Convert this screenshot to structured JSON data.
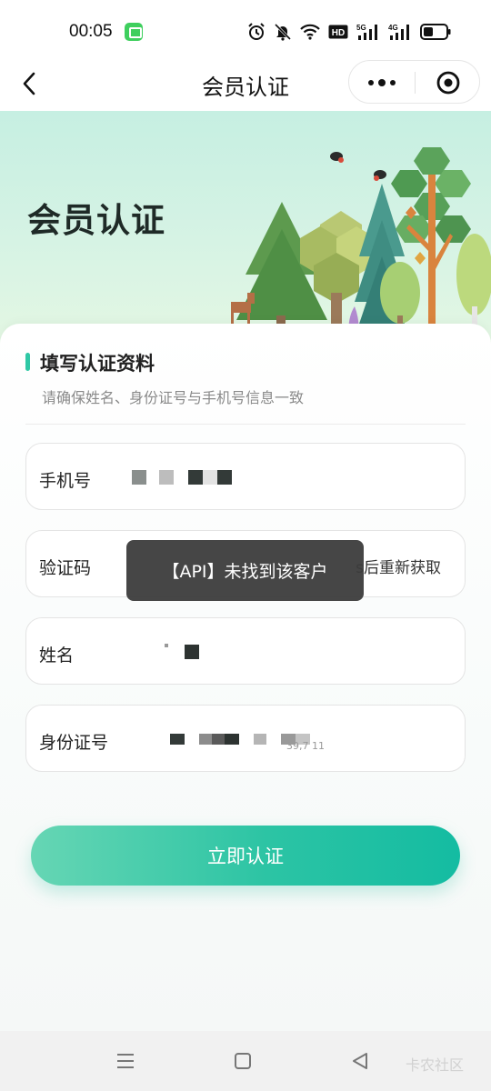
{
  "status_bar": {
    "time": "00:05",
    "icons": [
      "alarm-icon",
      "mute-icon",
      "wifi-icon",
      "hd-icon",
      "5g-signal-icon",
      "4g-signal-icon",
      "battery-icon"
    ],
    "hd_label": "HD",
    "net1_label": "5G",
    "net2_label": "4G"
  },
  "nav": {
    "title": "会员认证"
  },
  "hero": {
    "title": "会员认证"
  },
  "section": {
    "title": "填写认证资料",
    "subtitle": "请确保姓名、身份证号与手机号信息一致"
  },
  "fields": {
    "phone_label": "手机号",
    "code_label": "验证码",
    "code_resend": "s后重新获取",
    "name_label": "姓名",
    "idcard_label": "身份证号",
    "idcard_tail": "39,7 11"
  },
  "submit": {
    "label": "立即认证"
  },
  "toast": {
    "message": "【API】未找到该客户"
  },
  "watermark": "卡农社区",
  "colors": {
    "accent": "#2fc8a5",
    "button_start": "#66d6b4",
    "button_end": "#14bca2",
    "toast_bg": "#3c3c3c"
  }
}
